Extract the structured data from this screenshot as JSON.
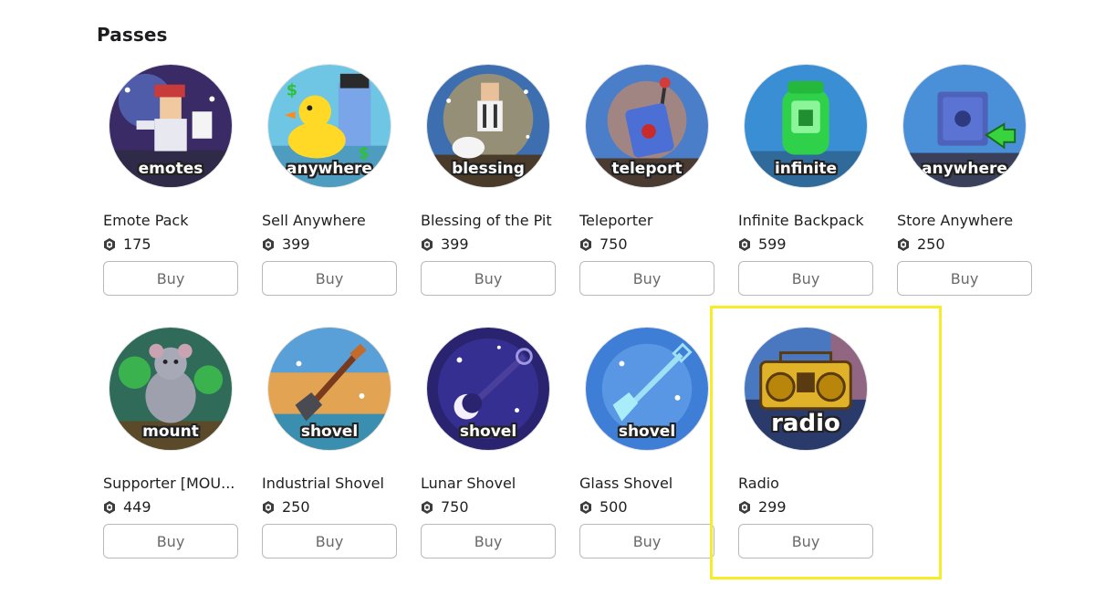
{
  "section": {
    "title": "Passes"
  },
  "buy_label": "Buy",
  "colors": {
    "highlight": "#f7ec28",
    "button_border": "#b9b9b9"
  },
  "passes": [
    {
      "name": "Emote Pack",
      "price": "175",
      "thumb_text": "emotes",
      "icon": "emote-avatars-icon"
    },
    {
      "name": "Sell Anywhere",
      "price": "399",
      "thumb_text": "anywhere",
      "icon": "rubber-duck-icon"
    },
    {
      "name": "Blessing of the Pit",
      "price": "399",
      "thumb_text": "blessing",
      "icon": "blessing-avatar-icon"
    },
    {
      "name": "Teleporter",
      "price": "750",
      "thumb_text": "teleport",
      "icon": "remote-control-icon"
    },
    {
      "name": "Infinite Backpack",
      "price": "599",
      "thumb_text": "infinite",
      "icon": "green-backpack-icon"
    },
    {
      "name": "Store Anywhere",
      "price": "250",
      "thumb_text": "anywhere",
      "icon": "safe-icon"
    },
    {
      "name": "Supporter [MOU...",
      "price": "449",
      "thumb_text": "mount",
      "icon": "rat-mount-icon"
    },
    {
      "name": "Industrial Shovel",
      "price": "250",
      "thumb_text": "shovel",
      "icon": "shovel-icon"
    },
    {
      "name": "Lunar Shovel",
      "price": "750",
      "thumb_text": "shovel",
      "icon": "lunar-shovel-icon"
    },
    {
      "name": "Glass Shovel",
      "price": "500",
      "thumb_text": "shovel",
      "icon": "glass-shovel-icon"
    },
    {
      "name": "Radio",
      "price": "299",
      "thumb_text": "radio",
      "icon": "radio-icon"
    }
  ]
}
